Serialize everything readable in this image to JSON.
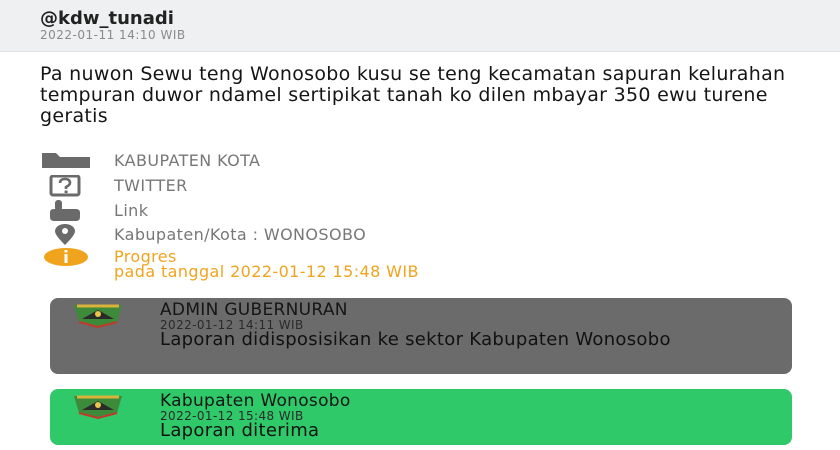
{
  "post": {
    "username": "@kdw_tunadi",
    "timestamp": "2022-01-11 14:10 WIB",
    "body": "Pa nuwon Sewu teng Wonosobo kusu se teng kecamatan sapuran kelurahan tempuran duwor ndamel sertipikat tanah ko dilen mbayar 350 ewu turene geratis"
  },
  "meta": {
    "category": {
      "icon": "folder-icon",
      "label": "KABUPATEN KOTA"
    },
    "source": {
      "icon": "question-box-icon",
      "label": "TWITTER"
    },
    "link": {
      "icon": "hand-pointer-icon",
      "label": "Link"
    },
    "location": {
      "icon": "location-pin-icon",
      "label": "Kabupaten/Kota : WONOSOBO"
    },
    "progress": {
      "icon": "info-icon",
      "status": "Progres",
      "date_line": "pada tanggal 2022-01-12 15:48 WIB",
      "color": "#f0a41e"
    }
  },
  "timeline": [
    {
      "title": "ADMIN GUBERNURAN",
      "timestamp": "2022-01-12 14:11 WIB",
      "message": "Laporan didisposisikan ke sektor Kabupaten Wonosobo",
      "color": "#6b6b6b"
    },
    {
      "title": "Kabupaten Wonosobo",
      "timestamp": "2022-01-12 15:48 WIB",
      "message": "Laporan diterima",
      "color": "#2fc96a"
    }
  ]
}
